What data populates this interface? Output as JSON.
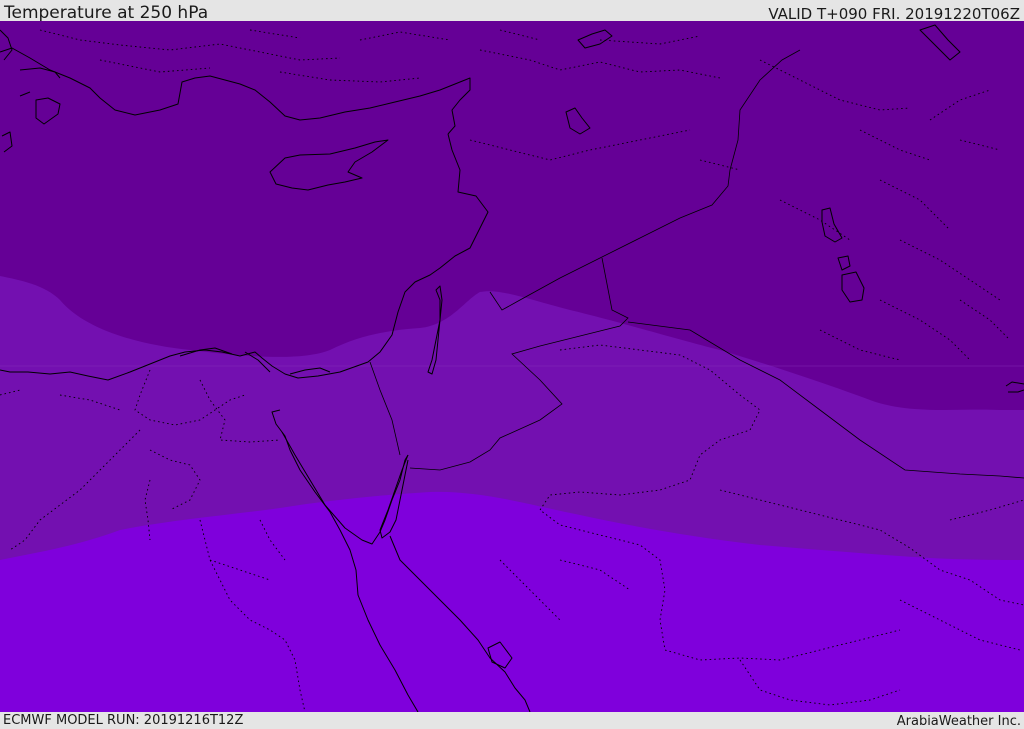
{
  "header": {
    "title": "Temperature at 250 hPa",
    "valid": "VALID T+090 FRI. 20191220T06Z"
  },
  "footer": {
    "model_run": "ECMWF MODEL RUN: 20191216T12Z",
    "brand": "ArabiaWeather Inc."
  },
  "colors": {
    "band_coldest": "#650096",
    "band_middle": "#7310b0",
    "band_warmest": "#7f00dc",
    "coastline": "#000000",
    "bar_background": "#e5e5e5"
  }
}
